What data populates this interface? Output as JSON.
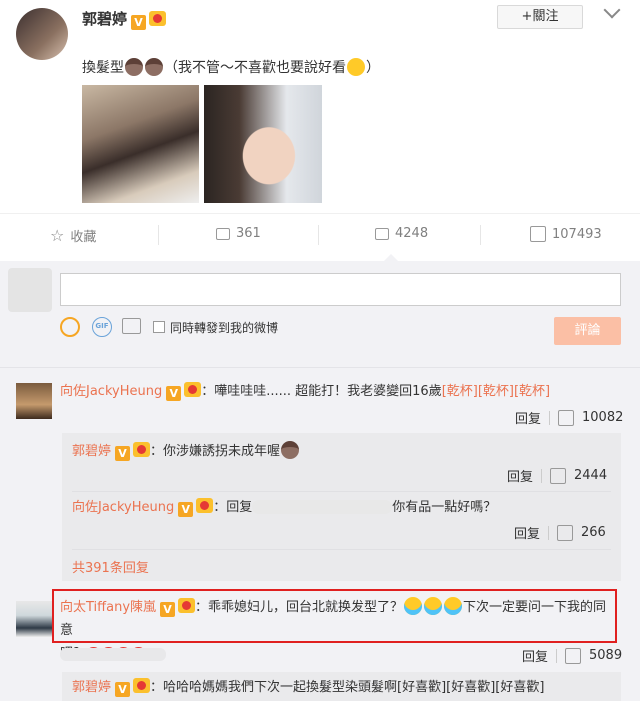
{
  "post": {
    "author": "郭碧婷",
    "follow_button": "+關注",
    "text": "換髮型",
    "text_suffix": "（我不管～不喜歡也要說好看",
    "text_close": "）"
  },
  "actions": {
    "favorite": "收藏",
    "repost_count": "361",
    "comment_count": "4248",
    "like_count": "107493"
  },
  "composer": {
    "gif_label": "GIF",
    "repost_checkbox_label": "同時轉發到我的微博",
    "submit_label": "評論"
  },
  "comments": [
    {
      "author": "向佐JackyHeung",
      "text_a": "：嘩哇哇哇...... 超能打！我老婆變回16歲",
      "text_b": "[乾杯][乾杯][乾杯]",
      "reply_label": "回复",
      "like_count": "10082",
      "replies": [
        {
          "author": "郭碧婷",
          "text": "：你涉嫌誘拐未成年喔",
          "reply_label": "回复",
          "like_count": "2444"
        },
        {
          "author": "向佐JackyHeung",
          "text_a": "：回复",
          "text_b": "你有品一點好嗎？",
          "reply_label": "回复",
          "like_count": "266"
        }
      ],
      "more_replies": "共391条回复"
    },
    {
      "author": "向太Tiffany陳嵐",
      "text_a": "：乖乖媳妇儿，回台北就换发型了？",
      "text_b": "下次一定要问一下我的同意",
      "text_c": "吧？",
      "reply_label": "回复",
      "like_count": "5089",
      "highlight_color": "#e02020"
    }
  ],
  "last_reply": {
    "author": "郭碧婷",
    "text": "：哈哈哈媽媽我們下次一起換髮型染頭髮啊[好喜歡][好喜歡][好喜歡]"
  }
}
